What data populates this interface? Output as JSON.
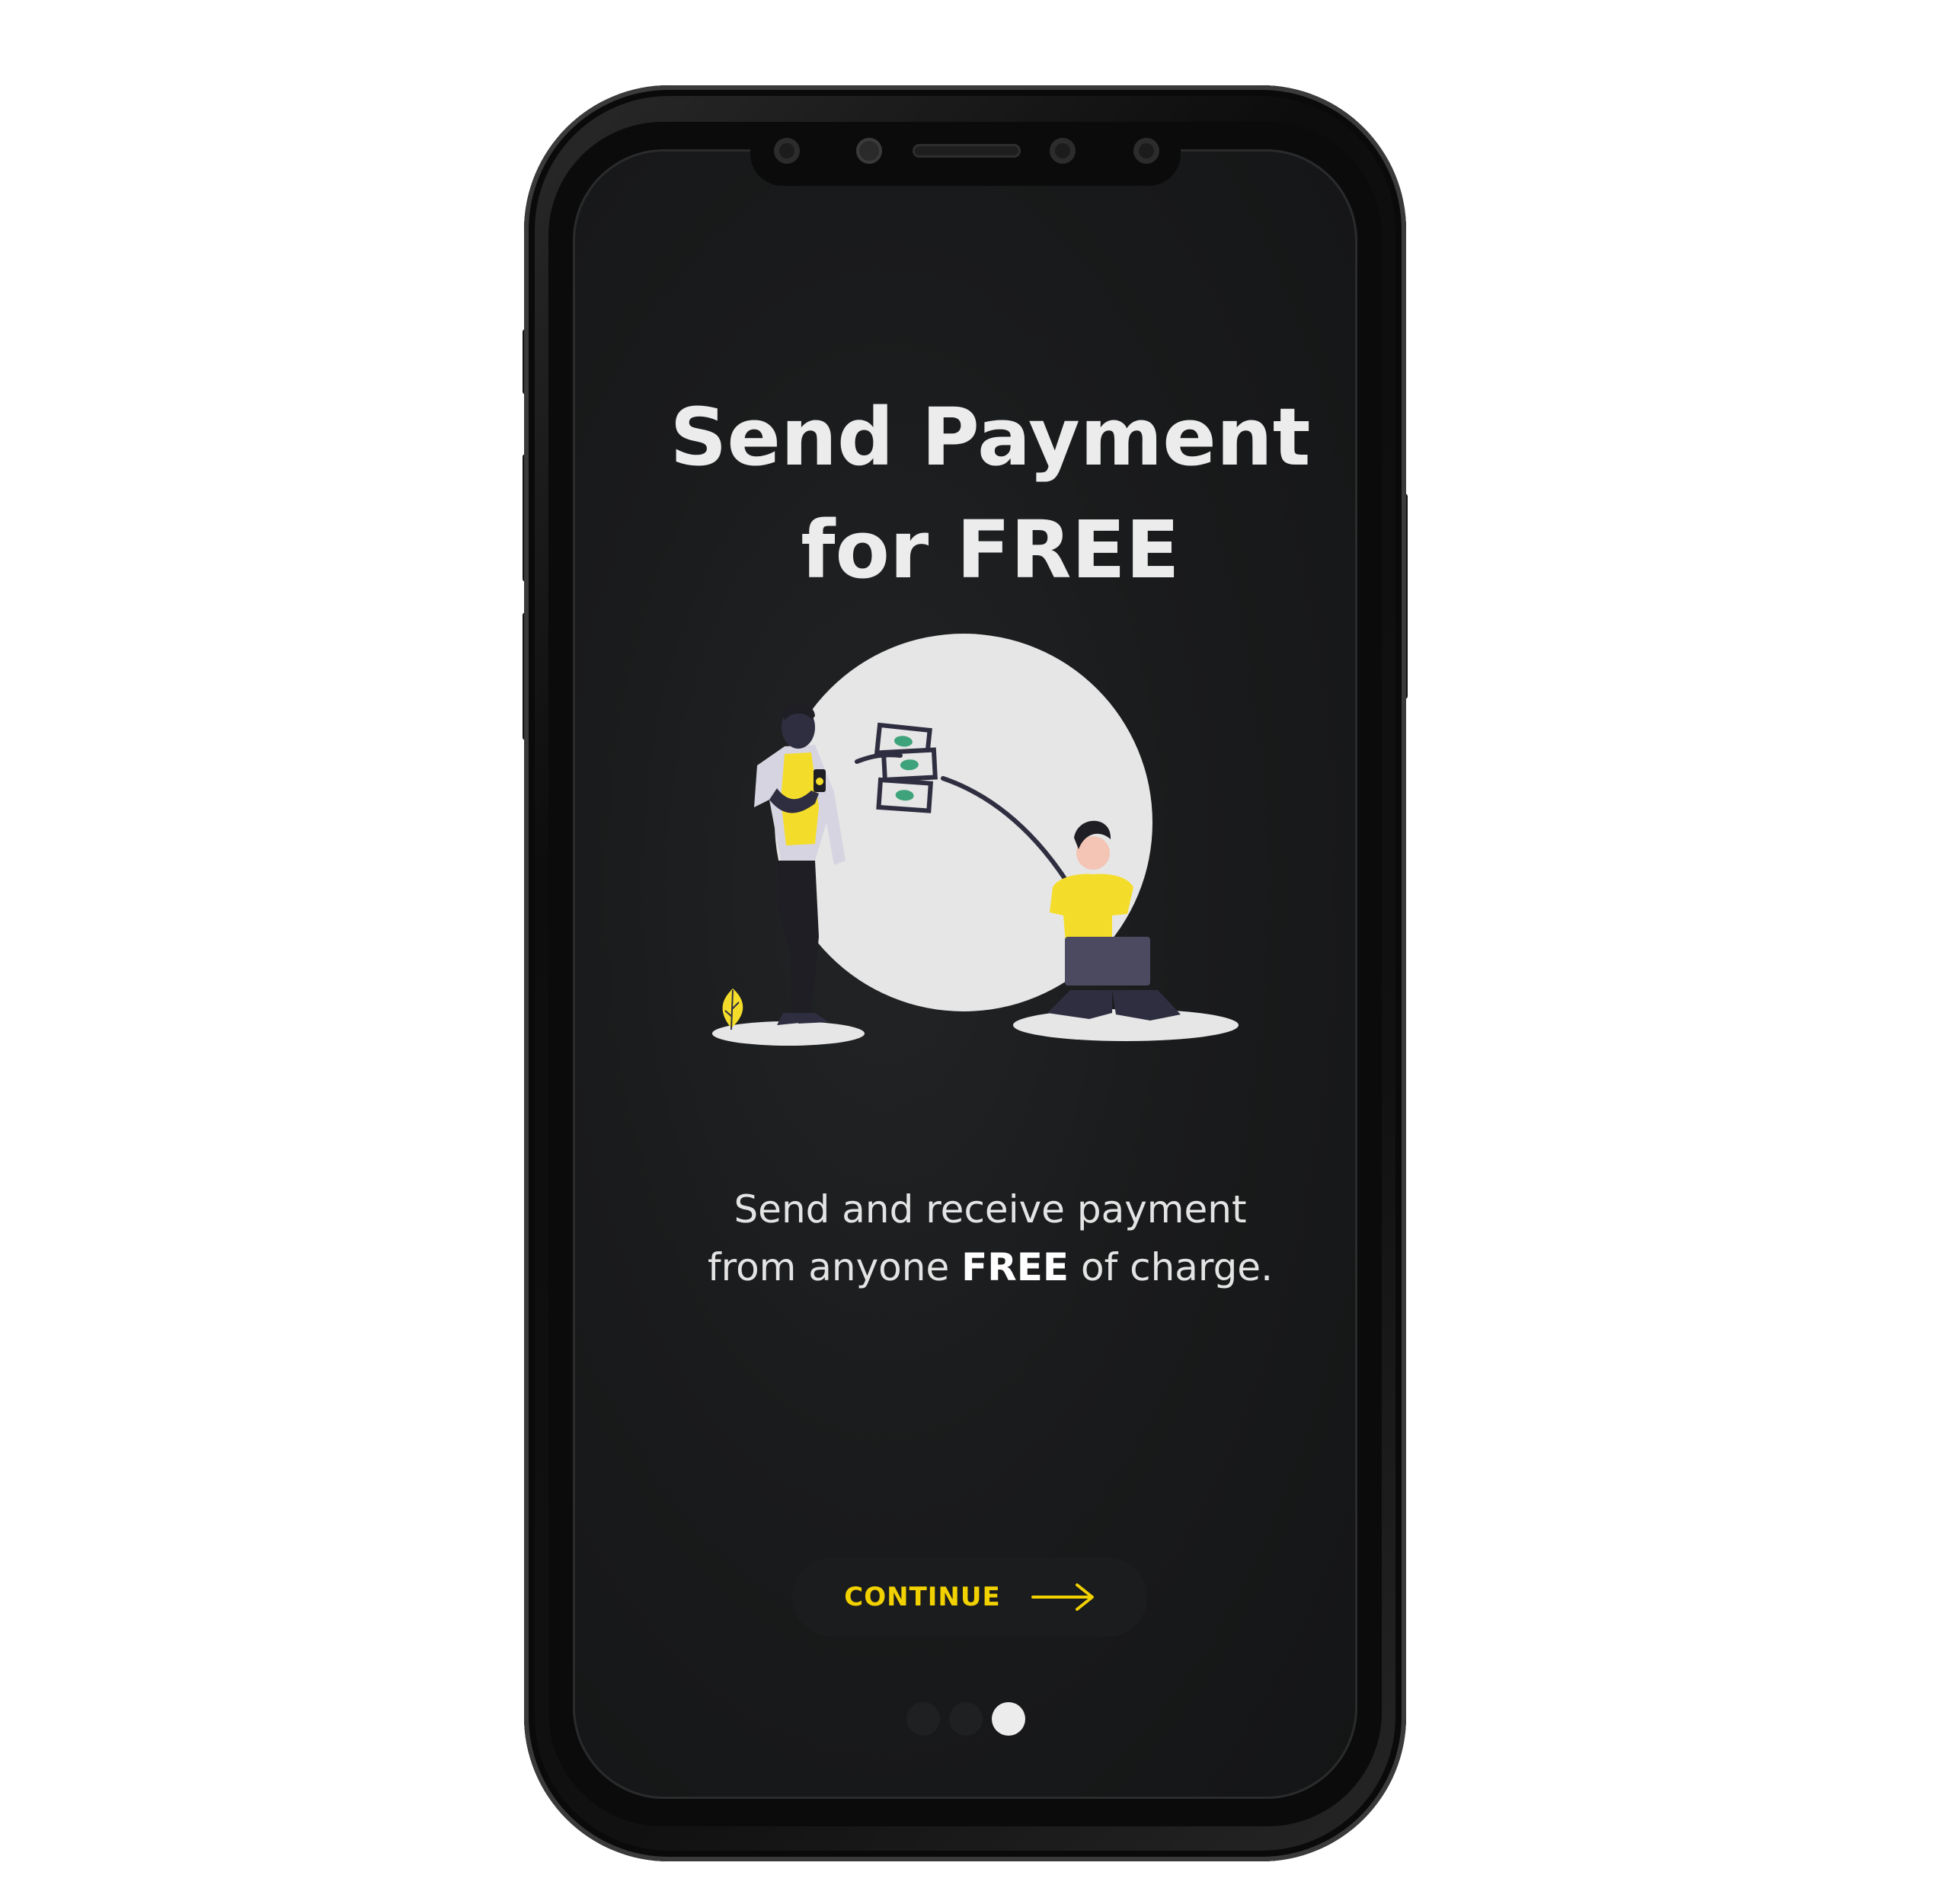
{
  "screen": {
    "title_line1": "Send Payment",
    "title_line2": "for FREE",
    "description_line1": "Send and receive payment",
    "description_line2_before": "from anyone ",
    "description_line2_bold": "FREE",
    "description_line2_after": " of charge."
  },
  "button": {
    "continue_label": "CONTINUE",
    "icon": "arrow-right-icon"
  },
  "pagination": {
    "total": 3,
    "active_index": 2
  },
  "illustration": {
    "subject": "payment-transfer-illustration"
  },
  "colors": {
    "accent": "#f2d100",
    "screen_bg": "#1a1b1c",
    "text": "#ececec",
    "illustration_circle": "#e6e6e6",
    "figure_yellow": "#f4dd2a",
    "figure_dark": "#2f2e41"
  }
}
